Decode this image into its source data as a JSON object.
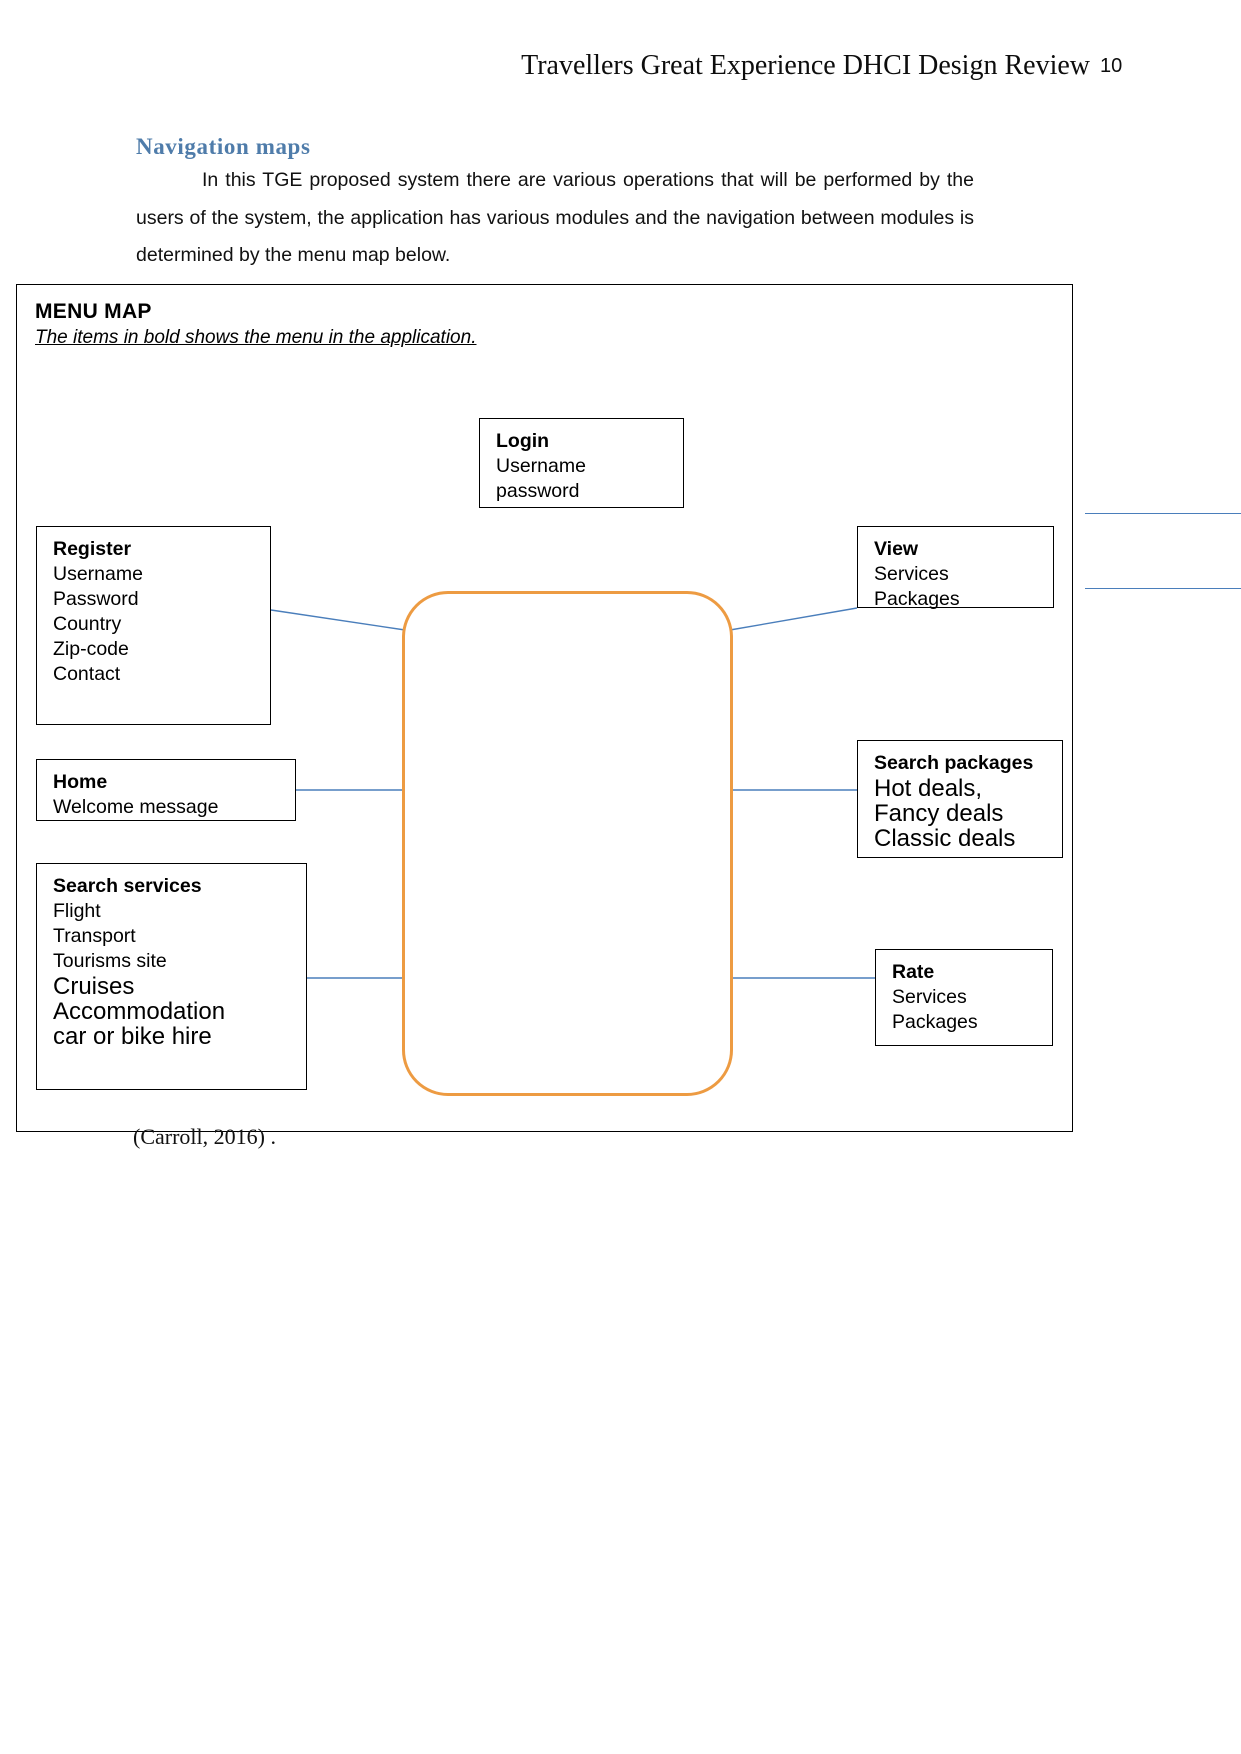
{
  "header": {
    "title": "Travellers Great Experience DHCI Design Review",
    "page_number": "10"
  },
  "section": {
    "heading": "Navigation  maps",
    "paragraph": "In this TGE proposed system there are various operations that will be performed by the users of the system, the application has various modules and the navigation between modules is determined by the menu map below."
  },
  "diagram": {
    "title": "MENU MAP",
    "subtitle": "The items in bold shows the menu in the application.",
    "central_shape_color": "#ed9b42",
    "connector_color": "#4a7ebb",
    "nodes": {
      "login": {
        "title": "Login",
        "items": [
          "Username",
          "password"
        ]
      },
      "register": {
        "title": "Register",
        "items": [
          "Username",
          "Password",
          "Country",
          "Zip-code",
          "Contact"
        ]
      },
      "home": {
        "title": "Home",
        "items": [
          "Welcome message"
        ]
      },
      "search_services": {
        "title": "Search services",
        "items": [
          "Flight",
          "Transport",
          "Tourisms site"
        ],
        "items_large": [
          "Cruises",
          "Accommodation",
          "car or bike hire"
        ]
      },
      "view": {
        "title": "View",
        "items": [
          "Services",
          "Packages"
        ]
      },
      "search_packages": {
        "title": "Search packages",
        "items_large": [
          "Hot  deals,",
          "Fancy deals",
          "Classic deals"
        ]
      },
      "rate": {
        "title": "Rate",
        "items": [
          "Services",
          "Packages"
        ]
      }
    }
  },
  "citation": "(Carroll, 2016) ."
}
